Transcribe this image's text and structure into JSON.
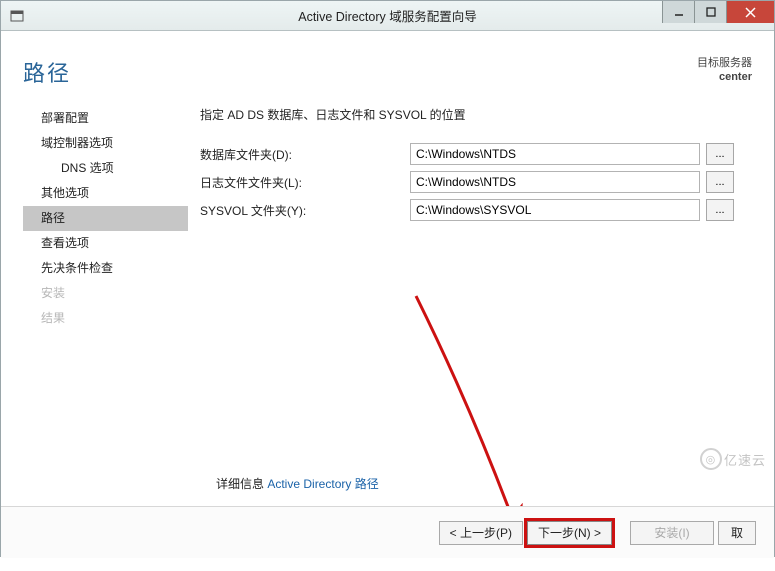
{
  "titlebar": {
    "title": "Active Directory 域服务配置向导"
  },
  "header": {
    "page_title": "路径",
    "target_label": "目标服务器",
    "target_name": "center"
  },
  "sidebar": {
    "items": [
      {
        "label": "部署配置",
        "kind": "normal"
      },
      {
        "label": "域控制器选项",
        "kind": "normal"
      },
      {
        "label": "DNS 选项",
        "kind": "sub"
      },
      {
        "label": "其他选项",
        "kind": "normal"
      },
      {
        "label": "路径",
        "kind": "active"
      },
      {
        "label": "查看选项",
        "kind": "normal"
      },
      {
        "label": "先决条件检查",
        "kind": "normal"
      },
      {
        "label": "安装",
        "kind": "disabled"
      },
      {
        "label": "结果",
        "kind": "disabled"
      }
    ]
  },
  "main": {
    "description": "指定 AD DS 数据库、日志文件和 SYSVOL 的位置",
    "rows": [
      {
        "label": "数据库文件夹(D):",
        "value": "C:\\Windows\\NTDS"
      },
      {
        "label": "日志文件文件夹(L):",
        "value": "C:\\Windows\\NTDS"
      },
      {
        "label": "SYSVOL 文件夹(Y):",
        "value": "C:\\Windows\\SYSVOL"
      }
    ],
    "browse_label": "..."
  },
  "link": {
    "prefix": "详细信息 ",
    "link_text": "Active Directory 路径"
  },
  "footer": {
    "prev": "< 上一步(P)",
    "next": "下一步(N) >",
    "install": "安装(I)",
    "cancel": "取"
  },
  "watermark": "亿速云"
}
